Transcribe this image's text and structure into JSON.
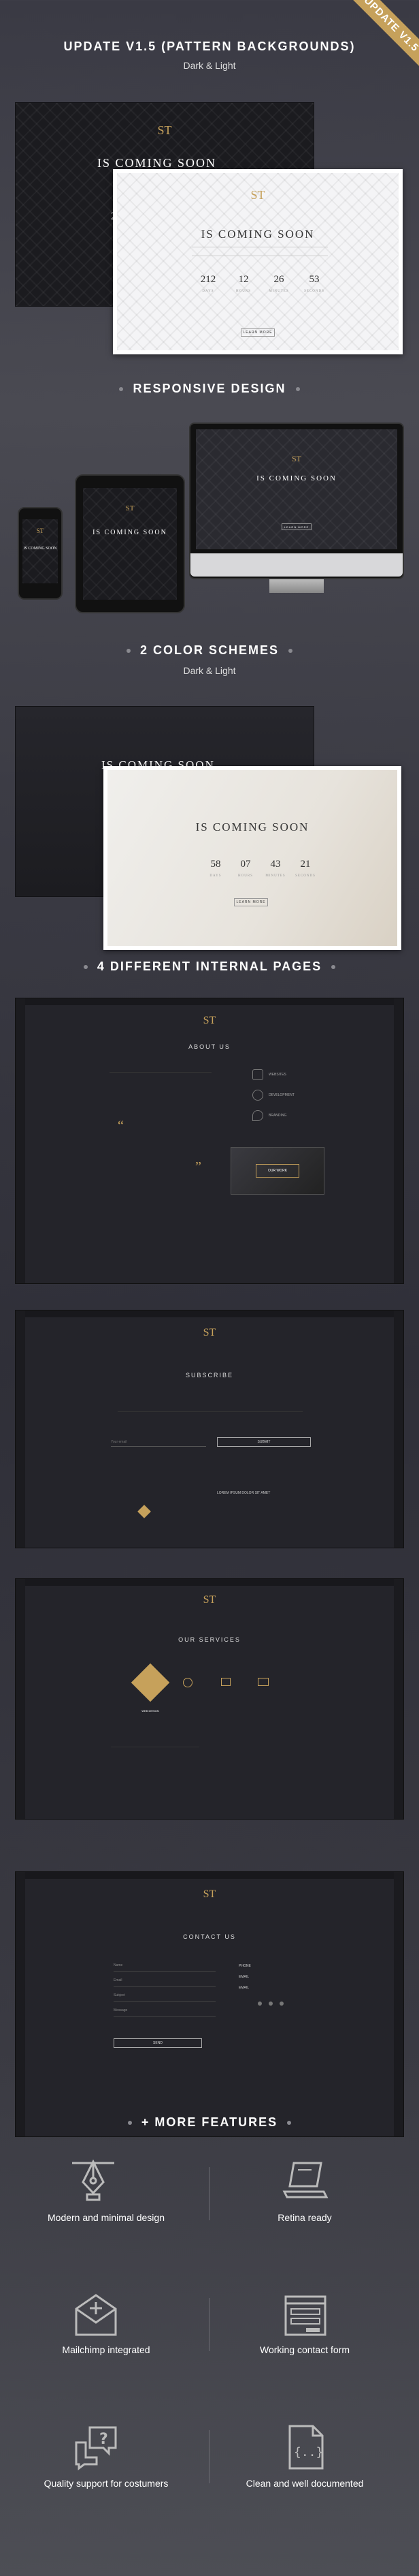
{
  "ribbon": "UPDATE V1.5",
  "section_update": {
    "title": "UPDATE V1.5 (PATTERN BACKGROUNDS)",
    "subtitle": "Dark & Light"
  },
  "section_responsive": {
    "title": "RESPONSIVE DESIGN"
  },
  "section_colors": {
    "title": "2 COLOR SCHEMES",
    "subtitle": "Dark & Light"
  },
  "section_pages": {
    "title": "4 DIFFERENT INTERNAL PAGES"
  },
  "section_features": {
    "title": "+ MORE FEATURES"
  },
  "coming_soon": "IS COMING SOON",
  "logo": "ST",
  "countdown_light": [
    {
      "n": "212",
      "l": "DAYS"
    },
    {
      "n": "12",
      "l": "HOURS"
    },
    {
      "n": "26",
      "l": "MINUTES"
    },
    {
      "n": "53",
      "l": "SECONDS"
    }
  ],
  "countdown_dark_partial": "212",
  "countdown_scheme": [
    {
      "n": "58",
      "l": "DAYS"
    },
    {
      "n": "07",
      "l": "HOURS"
    },
    {
      "n": "43",
      "l": "MINUTES"
    },
    {
      "n": "21",
      "l": "SECONDS"
    }
  ],
  "learn_more": "LEARN MORE",
  "pages": {
    "about": {
      "title": "ABOUT US",
      "items": [
        "WEBSITES",
        "DEVELOPMENT",
        "BRANDING"
      ],
      "card": "OUR WORK"
    },
    "subscribe": {
      "title": "SUBSCRIBE",
      "input": "Your email",
      "button": "SUBMIT",
      "links_title": "LOREM IPSUM DOLOR SIT AMET"
    },
    "services": {
      "title": "OUR SERVICES",
      "badge": "WEB DESIGN"
    },
    "contact": {
      "title": "CONTACT US",
      "fields": [
        "Name",
        "Email",
        "Subject",
        "Message"
      ],
      "button": "SEND",
      "info": [
        "PHONE",
        "EMAIL",
        "EMAIL"
      ]
    }
  },
  "features": [
    {
      "label": "Modern and minimal design",
      "icon": "pen-tool-icon"
    },
    {
      "label": "Retina ready",
      "icon": "laptop-icon"
    },
    {
      "label": "Mailchimp integrated",
      "icon": "mail-plus-icon"
    },
    {
      "label": "Working contact form",
      "icon": "form-icon"
    },
    {
      "label": "Quality support for costumers",
      "icon": "chat-question-icon"
    },
    {
      "label": "Clean and well documented",
      "icon": "code-file-icon"
    }
  ]
}
